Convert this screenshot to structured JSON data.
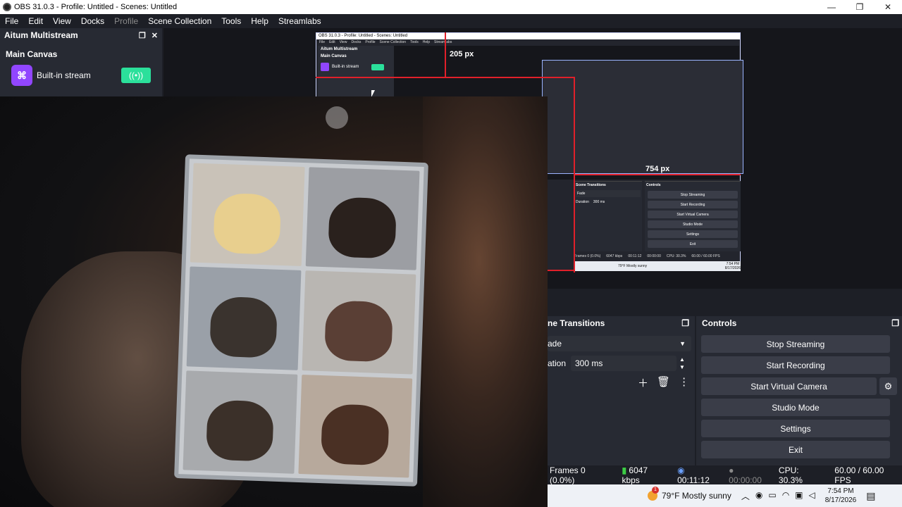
{
  "window": {
    "title": "OBS 31.0.3 - Profile: Untitled - Scenes: Untitled",
    "minimize": "—",
    "maximize": "❐",
    "close": "✕"
  },
  "menu": {
    "items": [
      "File",
      "Edit",
      "View",
      "Docks",
      "Profile",
      "Scene Collection",
      "Tools",
      "Help",
      "Streamlabs"
    ]
  },
  "multistream": {
    "dock_title": "Aitum Multistream",
    "canvas_title": "Main Canvas",
    "stream_label": "Built-in stream",
    "stream_icon": "twitch-icon",
    "live_icon": "broadcast-icon",
    "accent_color": "#2be09b"
  },
  "preview": {
    "px_top": "205 px",
    "px_right": "754 px",
    "nested_px": "754 px",
    "nested_title": "OBS 31.0.3 - Profile: Untitled - Scenes: Untitled",
    "nested_menu": [
      "File",
      "Edit",
      "View",
      "Docks",
      "Profile",
      "Scene Collection",
      "Tools",
      "Help",
      "Streamlabs"
    ],
    "nested_dock_title": "Aitum Multistream",
    "nested_canvas": "Main Canvas",
    "nested_stream": "Built-in stream",
    "nested_trans_title": "Scene Transitions",
    "nested_trans_value": "Fade",
    "nested_dur_label": "Duration",
    "nested_dur_value": "300 ms",
    "nested_controls_title": "Controls",
    "nested_buttons": [
      "Stop Streaming",
      "Start Recording",
      "Start Virtual Camera",
      "Studio Mode",
      "Settings",
      "Exit"
    ],
    "nested_status": [
      "Frames 0 (0.0%)",
      "6047 kbps",
      "00:11:12",
      "00:00:00",
      "CPU: 30.3%",
      "60.00 / 60.00 FPS"
    ],
    "nested_weather": "79°F  Mostly sunny",
    "nested_time": "7:54 PM",
    "nested_date": "8/17/2026"
  },
  "scene_transitions": {
    "title": "ne Transitions",
    "transition": "ade",
    "duration_label": "ation",
    "duration_value": "300 ms",
    "add_icon": "plus-icon",
    "delete_icon": "trash-icon",
    "more_icon": "more-vertical-icon"
  },
  "controls": {
    "title": "Controls",
    "stop_streaming": "Stop Streaming",
    "start_recording": "Start Recording",
    "start_virtual_camera": "Start Virtual Camera",
    "studio_mode": "Studio Mode",
    "settings": "Settings",
    "exit": "Exit"
  },
  "status": {
    "frames": "Frames 0 (0.0%)",
    "bitrate": "6047 kbps",
    "stream_time": "00:11:12",
    "record_time": "00:00:00",
    "cpu": "CPU: 30.3%",
    "fps": "60.00 / 60.00 FPS"
  },
  "taskbar": {
    "weather": "79°F  Mostly sunny",
    "weather_badge": "1",
    "time": "7:54 PM",
    "date": "8/17/2026",
    "notification_count": "1"
  }
}
